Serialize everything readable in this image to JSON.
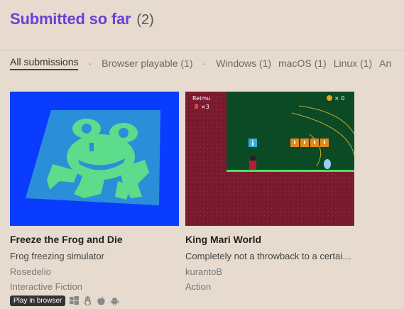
{
  "header": {
    "title": "Submitted so far",
    "count": "(2)"
  },
  "filters": [
    "All submissions",
    "Browser playable (1)",
    "Windows (1)",
    "macOS (1)",
    "Linux (1)",
    "An"
  ],
  "separator": "·",
  "games": [
    {
      "title": "Freeze the Frog and Die",
      "description": "Frog freezing simulator",
      "author": "Rosedelio",
      "genre": "Interactive Fiction",
      "badge": "Play in browser",
      "platform_icons": [
        "windows-icon",
        "linux-icon",
        "apple-icon",
        "android-icon"
      ]
    },
    {
      "title": "King Mari World",
      "description": "Completely not a throwback to a certain …",
      "author": "kurantoB",
      "genre": "Action",
      "thumb_text": {
        "player": "Reimu",
        "lives": "×3",
        "coins": "× 0"
      }
    }
  ],
  "colors": {
    "accent": "#6c3fd6",
    "background": "#e6dbce",
    "frog_bg": "#0a3cff",
    "frog_tile": "#2a8fd8",
    "frog_green": "#5ddc8c"
  }
}
